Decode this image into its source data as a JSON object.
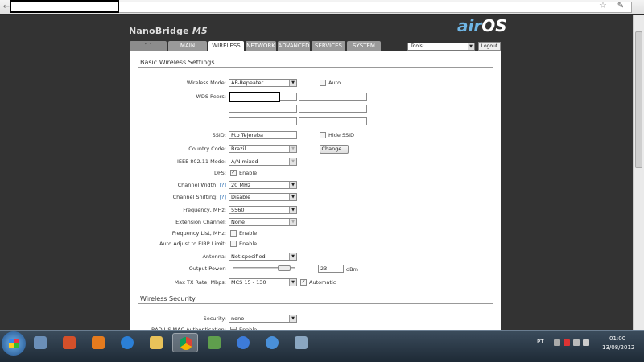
{
  "browser": {
    "url": ""
  },
  "header": {
    "model": "NanoBridge",
    "model_suffix": "M5",
    "brand_main": "air",
    "brand_suffix": "OS"
  },
  "tabs": [
    "MAIN",
    "WIRELESS",
    "NETWORK",
    "ADVANCED",
    "SERVICES",
    "SYSTEM"
  ],
  "active_tab": "WIRELESS",
  "tools": {
    "value": "Tools:",
    "logout": "Logout"
  },
  "basic": {
    "title": "Basic Wireless Settings",
    "wireless_mode": {
      "label": "Wireless Mode:",
      "value": "AP-Repeater",
      "auto_label": "Auto"
    },
    "wds_peers": {
      "label": "WDS Peers:"
    },
    "ssid": {
      "label": "SSID:",
      "value": "Ptp Tejereba",
      "hide_label": "Hide SSID"
    },
    "country": {
      "label": "Country Code:",
      "value": "Brazil",
      "change": "Change..."
    },
    "ieee": {
      "label": "IEEE 802.11 Mode:",
      "value": "A/N mixed"
    },
    "dfs": {
      "label": "DFS:",
      "value": "Enable"
    },
    "channel_width": {
      "label": "Channel Width:",
      "help": "[?]",
      "value": "20 MHz"
    },
    "channel_shifting": {
      "label": "Channel Shifting:",
      "help": "[?]",
      "value": "Disable"
    },
    "frequency": {
      "label": "Frequency, MHz:",
      "value": "5560"
    },
    "extension": {
      "label": "Extension Channel:",
      "value": "None"
    },
    "freq_list": {
      "label": "Frequency List, MHz:",
      "value": "Enable"
    },
    "auto_eirp": {
      "label": "Auto Adjust to EIRP Limit:",
      "value": "Enable"
    },
    "antenna": {
      "label": "Antenna:",
      "value": "Not specified"
    },
    "output_power": {
      "label": "Output Power:",
      "value": "23",
      "unit": "dBm",
      "level": 0.92
    },
    "max_tx": {
      "label": "Max TX Rate, Mbps:",
      "value": "MCS 15 - 130",
      "auto_label": "Automatic"
    }
  },
  "security": {
    "title": "Wireless Security",
    "security": {
      "label": "Security:",
      "value": "none"
    },
    "radius_mac": {
      "label": "RADIUS MAC Authentication:",
      "value": "Enable"
    }
  },
  "taskbar": {
    "lang": "PT",
    "time": "01:00",
    "date": "13/08/2012"
  },
  "colors": {
    "accent": "#6fb6e6",
    "tab_bg": "#9a9a9a",
    "panel_bg": "#ffffff",
    "page_bg": "#333333"
  }
}
